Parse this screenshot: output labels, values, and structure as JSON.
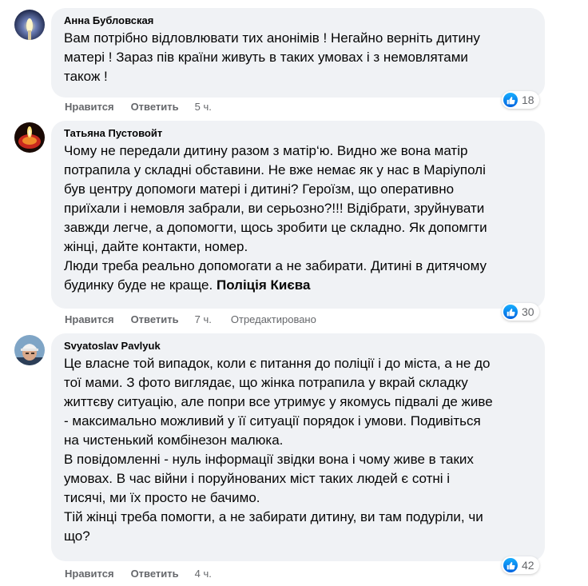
{
  "comments": [
    {
      "author": "Анна Бубловская",
      "lines": [
        "Вам потрібно відловлювати тих анонімів ! Негайно верніть дитину",
        "матері ! Зараз пів країни живуть в таких умовах і з немовлятами",
        "також !"
      ],
      "like_label": "Нравится",
      "reply_label": "Ответить",
      "time": "5 ч.",
      "reaction_count": "18",
      "avatar_icon": "avatar-candle-glow-icon"
    },
    {
      "author": "Татьяна Пустовойт",
      "lines": [
        "Чому не передали дитину разом з матір‘ю. Видно же вона матір",
        "потрапила у складні обставини. Не вже немає як у нас в Маріуполі",
        "був центру допомоги матері і дитині? Героїзм, що оперативно",
        "приїхали і немовля забрали, ви серьозно?!!! Відібрати, зруйнувати",
        "завжди легче, а допомогти, щось зробити це складно. Як допомгти",
        "жінці, дайте контакти, номер.",
        "Люди треба реально допомогати а не забирати. Дитині в дитячому",
        "будинку буде не краще."
      ],
      "mention": "Поліція Києва",
      "like_label": "Нравится",
      "reply_label": "Ответить",
      "time": "7 ч.",
      "edited_label": "Отредактировано",
      "reaction_count": "30",
      "avatar_icon": "avatar-candle-flame-icon"
    },
    {
      "author": "Svyatoslav Pavlyuk",
      "lines": [
        "Це власне той випадок, коли є питання до поліції і до міста, а не до",
        "тої мами. З фото виглядає, що жінка потрапила у вкрай складку",
        "життєву ситуацію, але попри все утримує у якомусь підвалі де живе",
        "- максимально можливий у її ситуації порядок і умови. Подивіться",
        "на чистенький комбінезон малюка.",
        "В повідомленні - нуль інформації звідки вона і чому живе в таких",
        "умовах. В час війни і поруйнованих міст таких людей є сотні і",
        "тисячі, ми їх просто не бачимо.",
        "Тій жінці треба помогти, а не забирати дитину, ви там подуріли, чи",
        "що?"
      ],
      "like_label": "Нравится",
      "reply_label": "Ответить",
      "time": "4 ч.",
      "reaction_count": "42",
      "avatar_icon": "avatar-man-helmet-icon"
    }
  ],
  "colors": {
    "bubble": "#f0f2f5",
    "meta_text": "#65676b",
    "like_blue": "#1877f2"
  }
}
